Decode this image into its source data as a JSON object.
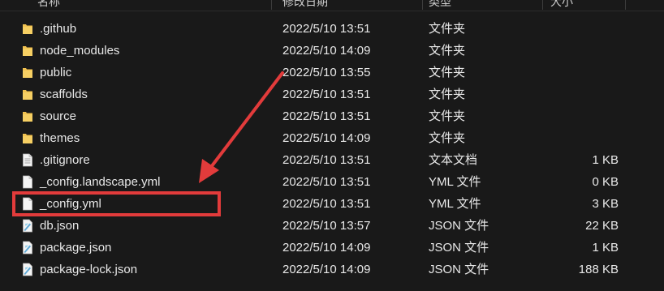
{
  "header": {
    "name": "名称",
    "date": "修改日期",
    "type": "类型",
    "size": "大小"
  },
  "files": [
    {
      "name": ".github",
      "date": "2022/5/10 13:51",
      "type": "文件夹",
      "size": "",
      "icon": "folder-icon"
    },
    {
      "name": "node_modules",
      "date": "2022/5/10 14:09",
      "type": "文件夹",
      "size": "",
      "icon": "folder-icon"
    },
    {
      "name": "public",
      "date": "2022/5/10 13:55",
      "type": "文件夹",
      "size": "",
      "icon": "folder-icon"
    },
    {
      "name": "scaffolds",
      "date": "2022/5/10 13:51",
      "type": "文件夹",
      "size": "",
      "icon": "folder-icon"
    },
    {
      "name": "source",
      "date": "2022/5/10 13:51",
      "type": "文件夹",
      "size": "",
      "icon": "folder-icon"
    },
    {
      "name": "themes",
      "date": "2022/5/10 14:09",
      "type": "文件夹",
      "size": "",
      "icon": "folder-icon"
    },
    {
      "name": ".gitignore",
      "date": "2022/5/10 13:51",
      "type": "文本文档",
      "size": "1 KB",
      "icon": "text-file-icon"
    },
    {
      "name": "_config.landscape.yml",
      "date": "2022/5/10 13:51",
      "type": "YML 文件",
      "size": "0 KB",
      "icon": "file-icon"
    },
    {
      "name": "_config.yml",
      "date": "2022/5/10 13:51",
      "type": "YML 文件",
      "size": "3 KB",
      "icon": "file-icon"
    },
    {
      "name": "db.json",
      "date": "2022/5/10 13:57",
      "type": "JSON 文件",
      "size": "22 KB",
      "icon": "json-file-icon"
    },
    {
      "name": "package.json",
      "date": "2022/5/10 14:09",
      "type": "JSON 文件",
      "size": "1 KB",
      "icon": "json-file-icon"
    },
    {
      "name": "package-lock.json",
      "date": "2022/5/10 14:09",
      "type": "JSON 文件",
      "size": "188 KB",
      "icon": "json-file-icon"
    }
  ],
  "colors": {
    "background": "#191919",
    "text": "#e8e8e8",
    "folder": "#f2c250",
    "annotation": "#e23b3b"
  }
}
